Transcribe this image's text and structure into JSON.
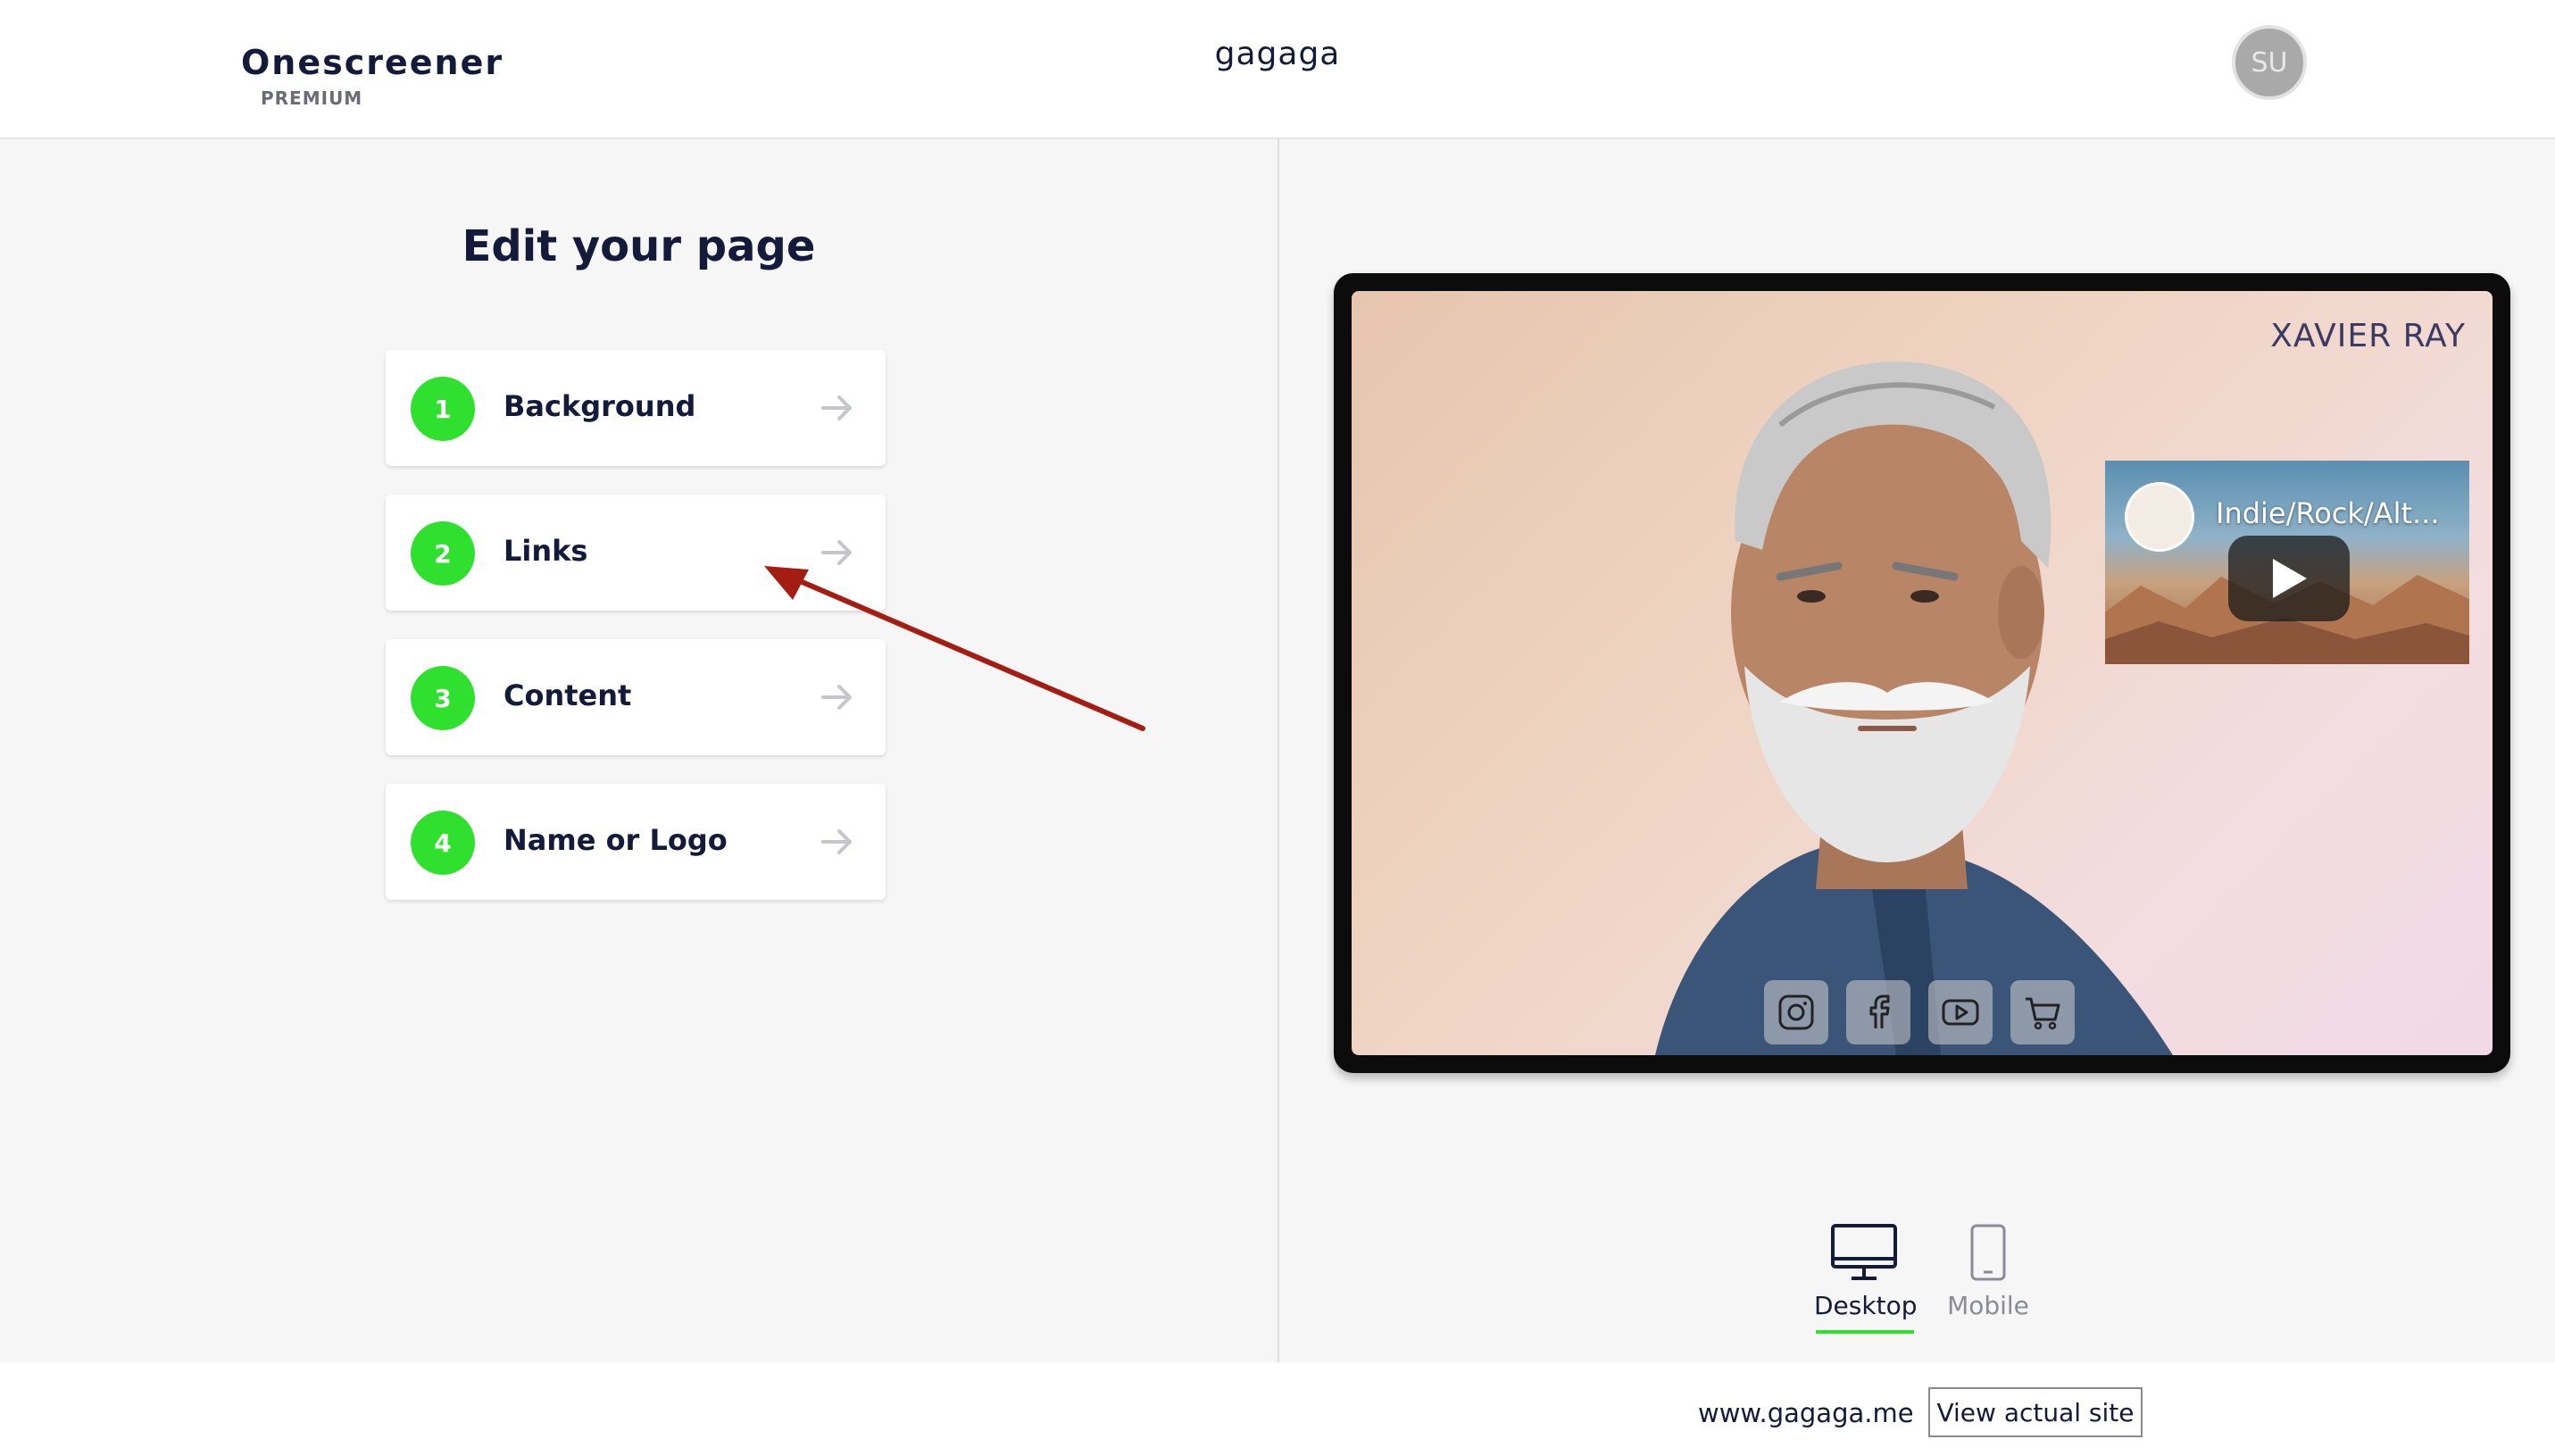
{
  "header": {
    "brand_name": "Onescreener",
    "brand_tier": "PREMIUM",
    "site_title": "gagaga",
    "avatar_initials": "SU"
  },
  "editor": {
    "title": "Edit your page",
    "steps": [
      {
        "number": "1",
        "label": "Background"
      },
      {
        "number": "2",
        "label": "Links"
      },
      {
        "number": "3",
        "label": "Content"
      },
      {
        "number": "4",
        "label": "Name or Logo"
      }
    ]
  },
  "preview": {
    "name": "XAVIER RAY",
    "video_title": "Indie/Rock/Alt...",
    "social_icons": [
      "instagram-icon",
      "facebook-icon",
      "youtube-icon",
      "cart-icon"
    ]
  },
  "view_toggle": {
    "desktop_label": "Desktop",
    "mobile_label": "Mobile",
    "selected": "Desktop"
  },
  "footer": {
    "url": "www.gagaga.me",
    "view_site_label": "View actual site"
  },
  "colors": {
    "accent_green": "#2fe02f",
    "annotation_red": "#a51d12",
    "brand_dark": "#141b3a"
  }
}
